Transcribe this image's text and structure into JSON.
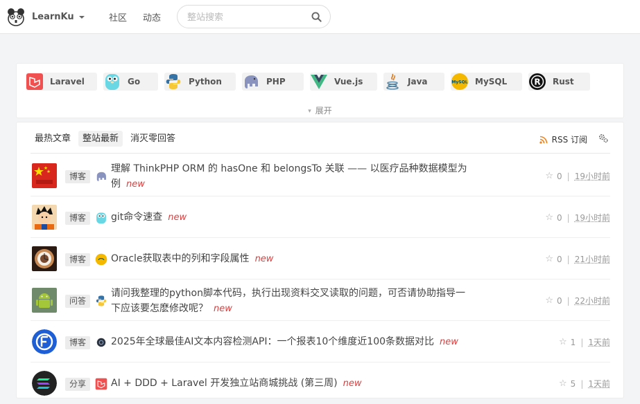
{
  "nav": {
    "brand": "LearnKu",
    "links": [
      "社区",
      "动态"
    ],
    "search_placeholder": "整站搜索"
  },
  "categories": [
    {
      "label": "Laravel",
      "icon": "laravel-icon"
    },
    {
      "label": "Go",
      "icon": "go-gopher-icon"
    },
    {
      "label": "Python",
      "icon": "python-icon"
    },
    {
      "label": "PHP",
      "icon": "php-elephant-icon"
    },
    {
      "label": "Vue.js",
      "icon": "vue-icon"
    },
    {
      "label": "Java",
      "icon": "java-icon"
    },
    {
      "label": "MySQL",
      "icon": "mysql-icon"
    },
    {
      "label": "Rust",
      "icon": "rust-icon"
    }
  ],
  "expand_label": "展开",
  "tabs": [
    {
      "label": "最热文章",
      "active": false
    },
    {
      "label": "整站最新",
      "active": true
    },
    {
      "label": "消灭零回答",
      "active": false
    }
  ],
  "rss_label": "RSS 订阅",
  "new_label": "new",
  "articles": [
    {
      "badge": "博客",
      "tech_icon": "php-elephant-icon",
      "title_lines": [
        "理解 ThinkPHP ORM 的 hasOne 和 belongsTo 关联 —— 以医疗品种数据模型为",
        "例"
      ],
      "votes": "0",
      "time": "19小时前",
      "avatar": "avatar-red-flag"
    },
    {
      "badge": "博客",
      "tech_icon": "go-gopher-icon",
      "title_lines": [
        "git命令速查"
      ],
      "votes": "0",
      "time": "19小时前",
      "avatar": "avatar-cartoon-boy"
    },
    {
      "badge": "博客",
      "tech_icon": "mysql-icon",
      "title_lines": [
        "Oracle获取表中的列和字段属性"
      ],
      "votes": "0",
      "time": "21小时前",
      "avatar": "avatar-clock-photo"
    },
    {
      "badge": "问答",
      "tech_icon": "python-icon",
      "title_lines": [
        "请问我整理的python脚本代码，执行出现资料交叉读取的问题，可否请协助指导一",
        "下应该要怎麽修改呢？"
      ],
      "votes": "0",
      "time": "22小时前",
      "avatar": "avatar-android-robot"
    },
    {
      "badge": "博客",
      "tech_icon": "dark-circle-icon",
      "title_lines": [
        "2025年全球最佳AI文本内容检测API：一个报表10个维度近100条数据对比"
      ],
      "votes": "1",
      "time": "1天前",
      "avatar": "avatar-blue-logo"
    },
    {
      "badge": "分享",
      "tech_icon": "laravel-icon",
      "title_lines": [
        "AI + DDD + Laravel 开发独立站商城挑战 (第三周)"
      ],
      "votes": "5",
      "time": "1天前",
      "avatar": "avatar-solana-logo"
    }
  ],
  "colors": {
    "new": "#d94040",
    "rss": "#f0821e",
    "laravel": "#f0504f",
    "vue": "#41b883"
  }
}
